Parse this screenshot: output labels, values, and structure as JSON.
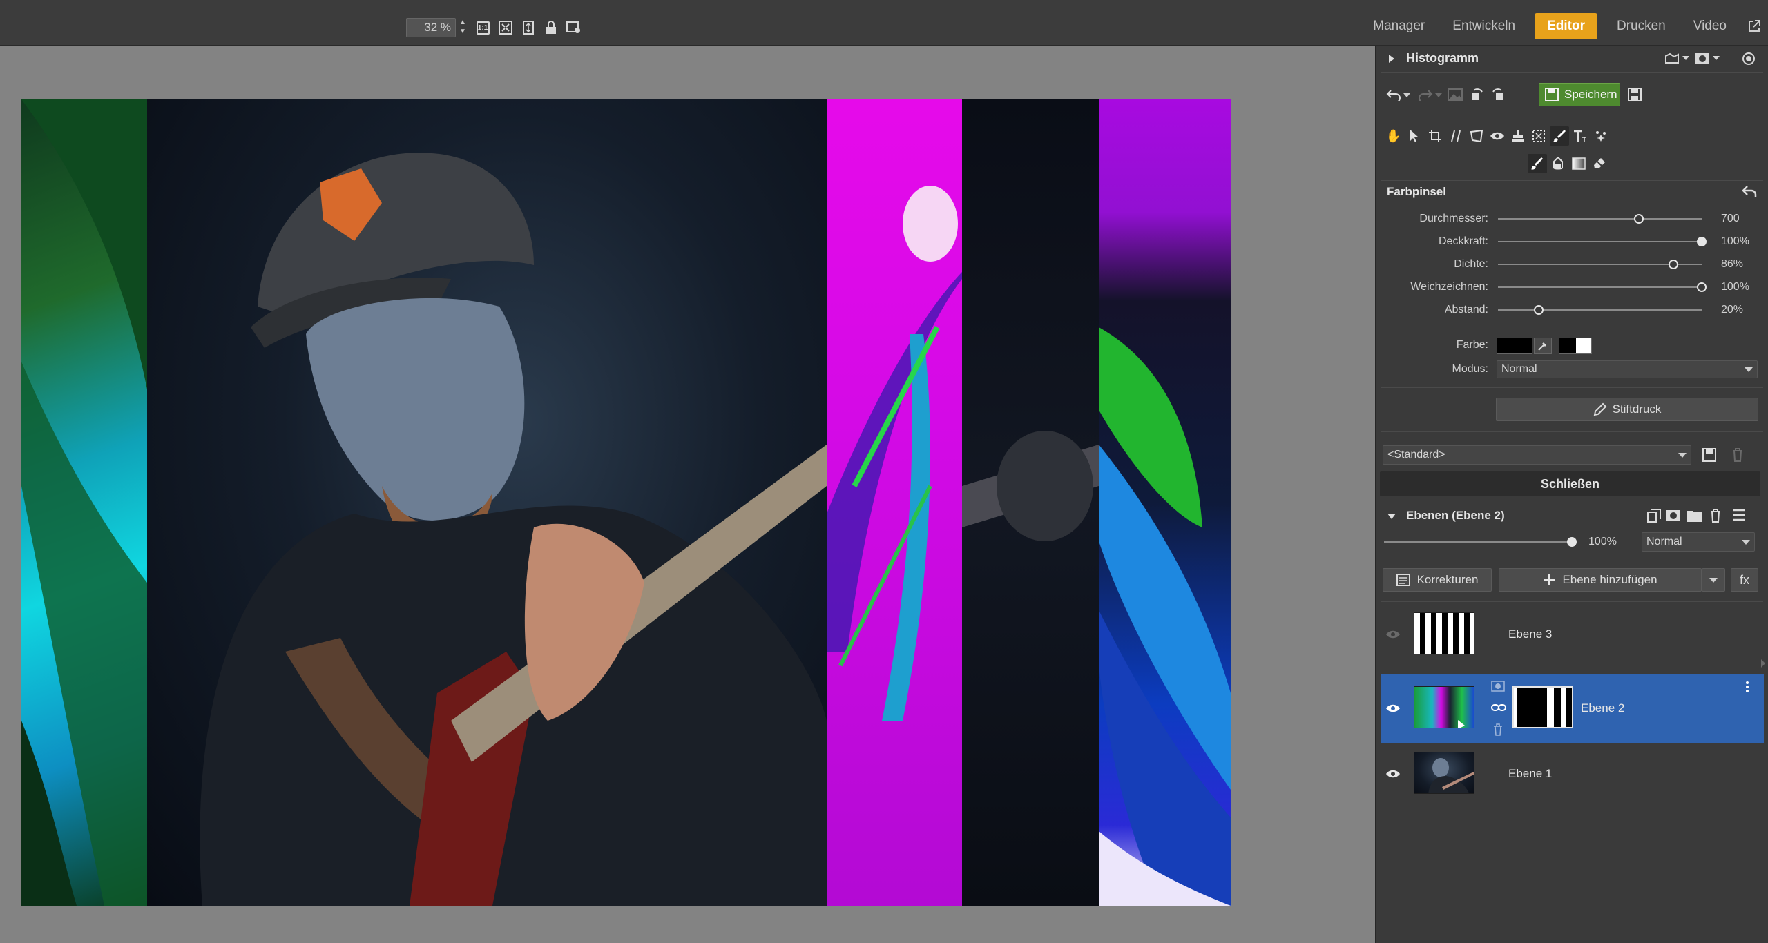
{
  "topbar": {
    "zoom_value": "32 %",
    "one_to_one_label": "1:1",
    "modes": [
      {
        "label": "Manager",
        "active": false
      },
      {
        "label": "Entwickeln",
        "active": false
      },
      {
        "label": "Editor",
        "active": true
      },
      {
        "label": "Drucken",
        "active": false
      },
      {
        "label": "Video",
        "active": false
      }
    ]
  },
  "panel": {
    "histogram_label": "Histogramm",
    "save_label": "Speichern",
    "brush_title": "Farbpinsel",
    "sliders": [
      {
        "label": "Durchmesser:",
        "value": "700",
        "fraction": 0.69
      },
      {
        "label": "Deckkraft:",
        "value": "100%",
        "fraction": 1.0
      },
      {
        "label": "Dichte:",
        "value": "86%",
        "fraction": 0.86
      },
      {
        "label": "Weichzeichnen:",
        "value": "100%",
        "fraction": 1.0
      },
      {
        "label": "Abstand:",
        "value": "20%",
        "fraction": 0.2
      }
    ],
    "color_label": "Farbe:",
    "mode_label": "Modus:",
    "mode_value": "Normal",
    "pen_pressure_label": "Stiftdruck",
    "preset_value": "<Standard>",
    "close_label": "Schließen",
    "layers_title": "Ebenen (Ebene 2)",
    "layer_opacity": "100%",
    "layer_opacity_fraction": 1.0,
    "blend_mode": "Normal",
    "corrections_label": "Korrekturen",
    "add_layer_label": "Ebene hinzufügen",
    "fx_label": "fx",
    "layers": [
      {
        "name": "Ebene 3",
        "visible": false,
        "selected": false
      },
      {
        "name": "Ebene 2",
        "visible": true,
        "selected": true
      },
      {
        "name": "Ebene 1",
        "visible": true,
        "selected": false
      }
    ]
  },
  "colors": {
    "accent": "#e8a21b",
    "save_green": "#4e8a2f",
    "selection_blue": "#2f63b0",
    "panel_bg": "#3a3a3a",
    "canvas_bg": "#838383"
  }
}
